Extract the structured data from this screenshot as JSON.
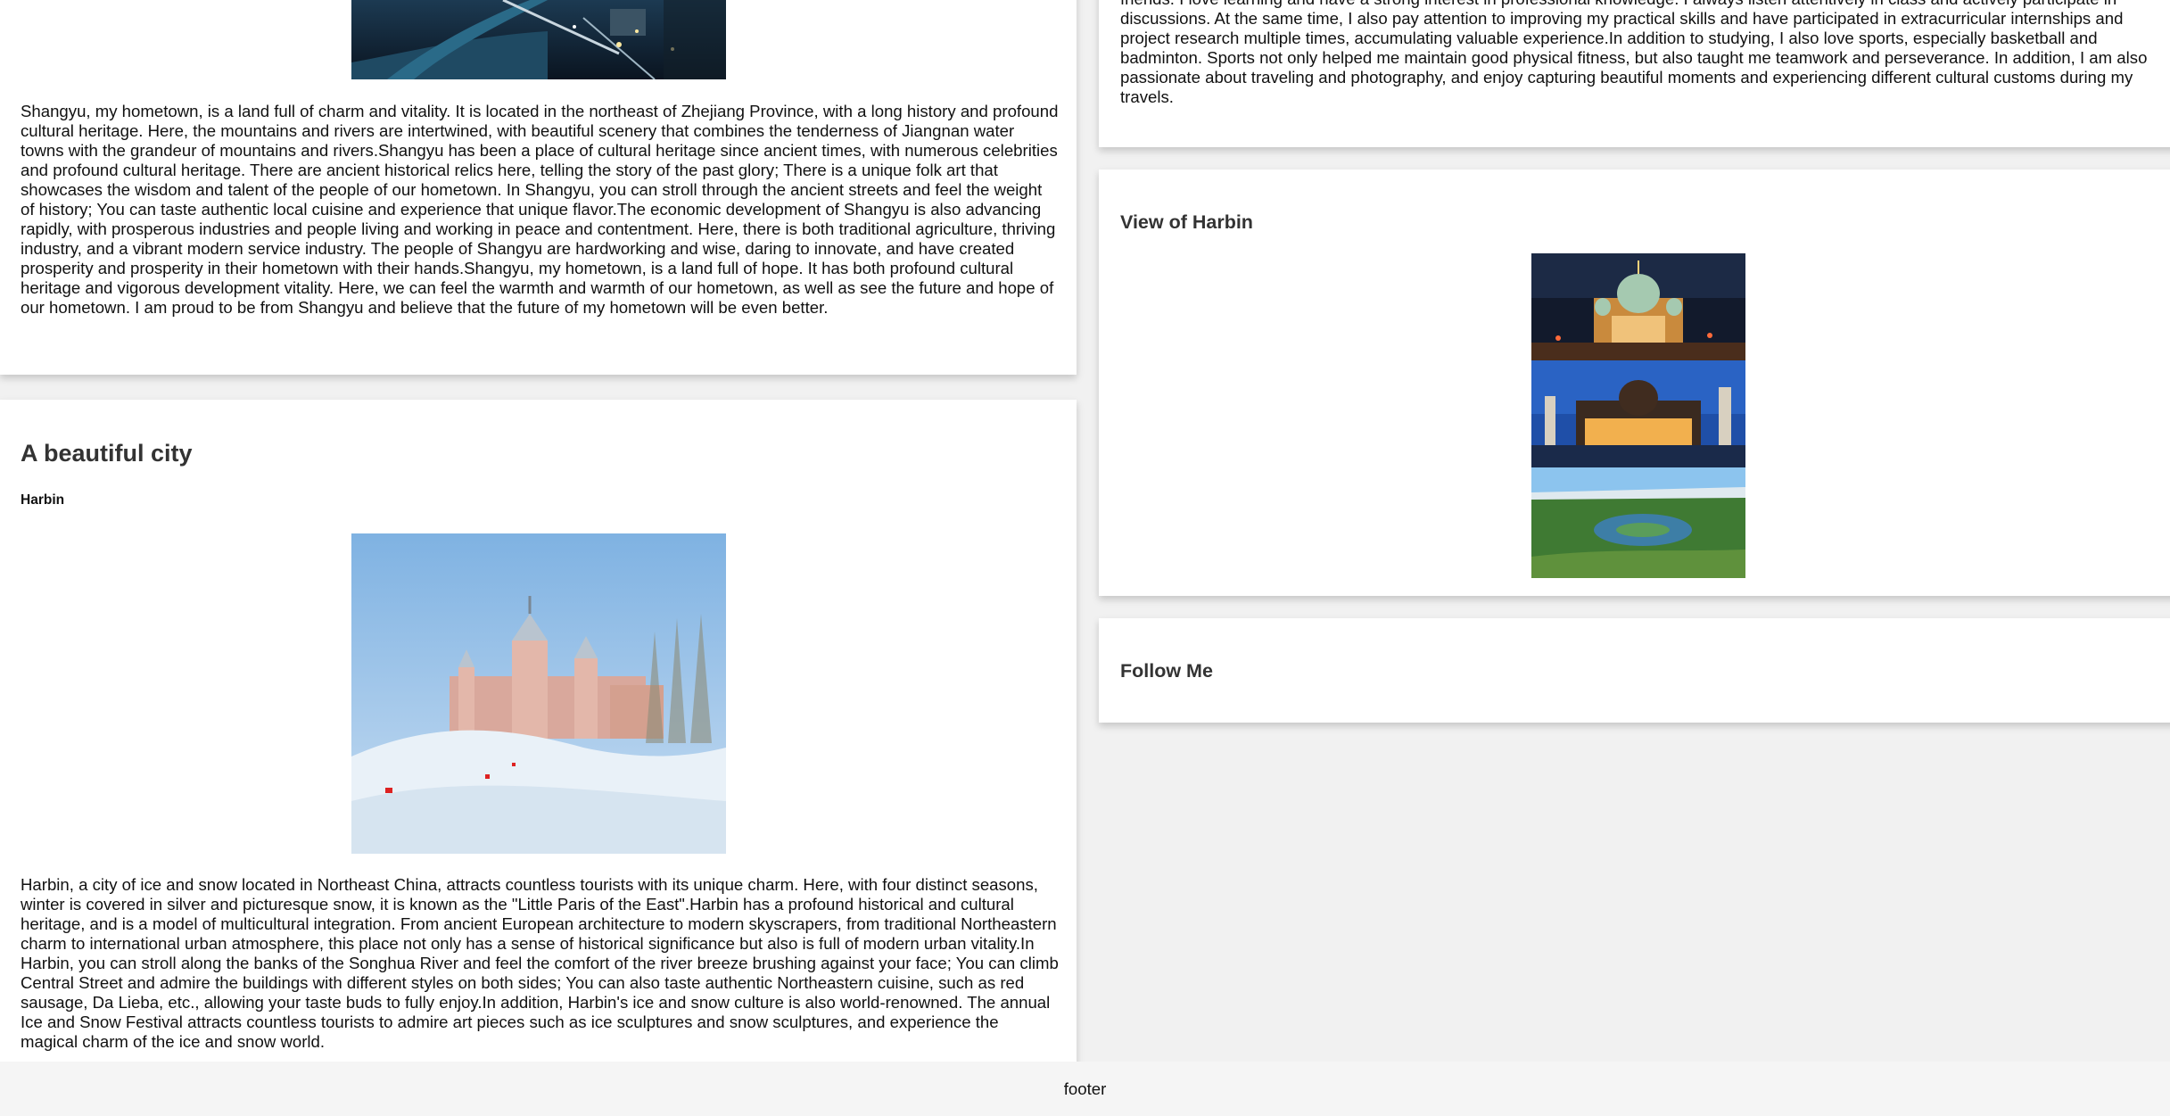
{
  "left": {
    "hometown_paragraph": "Shangyu, my hometown, is a land full of charm and vitality. It is located in the northeast of Zhejiang Province, with a long history and profound cultural heritage. Here, the mountains and rivers are intertwined, with beautiful scenery that combines the tenderness of Jiangnan water towns with the grandeur of mountains and rivers.Shangyu has been a place of cultural heritage since ancient times, with numerous celebrities and profound cultural heritage. There are ancient historical relics here, telling the story of the past glory; There is a unique folk art that showcases the wisdom and talent of the people of our hometown. In Shangyu, you can stroll through the ancient streets and feel the weight of history; You can taste authentic local cuisine and experience that unique flavor.The economic development of Shangyu is also advancing rapidly, with prosperous industries and people living and working in peace and contentment. Here, there is both traditional agriculture, thriving industry, and a vibrant modern service industry. The people of Shangyu are hardworking and wise, daring to innovate, and have created prosperity and prosperity in their hometown with their hands.Shangyu, my hometown, is a land full of hope. It has both profound cultural heritage and vigorous development vitality. Here, we can feel the warmth and warmth of our hometown, as well as see the future and hope of our hometown. I am proud to be from Shangyu and believe that the future of my hometown will be even better.",
    "city_title": "A beautiful city",
    "city_subtitle": "Harbin",
    "city_paragraph": "Harbin, a city of ice and snow located in Northeast China, attracts countless tourists with its unique charm. Here, with four distinct seasons, winter is covered in silver and picturesque snow, it is known as the \"Little Paris of the East\".Harbin has a profound historical and cultural heritage, and is a model of multicultural integration. From ancient European architecture to modern skyscrapers, from traditional Northeastern charm to international urban atmosphere, this place not only has a sense of historical significance but also is full of modern urban vitality.In Harbin, you can stroll along the banks of the Songhua River and feel the comfort of the river breeze brushing against your face; You can climb Central Street and admire the buildings with different styles on both sides; You can also taste authentic Northeastern cuisine, such as red sausage, Da Lieba, etc., allowing your taste buds to fully enjoy.In addition, Harbin's ice and snow culture is also world-renowned. The annual Ice and Snow Festival attracts countless tourists to admire art pieces such as ice sculptures and snow sculptures, and experience the magical charm of the ice and snow world."
  },
  "right": {
    "about_paragraph": "friends. I love learning and have a strong interest in professional knowledge. I always listen attentively in class and actively participate in discussions. At the same time, I also pay attention to improving my practical skills and have participated in extracurricular internships and project research multiple times, accumulating valuable experience.In addition to studying, I also love sports, especially basketball and badminton. Sports not only helped me maintain good physical fitness, but also taught me teamwork and perseverance. In addition, I am also passionate about traveling and photography, and enjoy capturing beautiful moments and experiencing different cultural customs during my travels.",
    "view_title": "View of Harbin",
    "follow_title": "Follow Me"
  },
  "footer": {
    "text": "footer"
  },
  "colors": {
    "page_bg": "#f1f1f1",
    "card_bg": "#ffffff",
    "heading": "#333333",
    "footer_bg": "#f5f5f5"
  },
  "icons": [
    "night-city-image",
    "snow-castle-image",
    "cathedral-night-image",
    "palace-night-image",
    "park-aerial-image"
  ]
}
